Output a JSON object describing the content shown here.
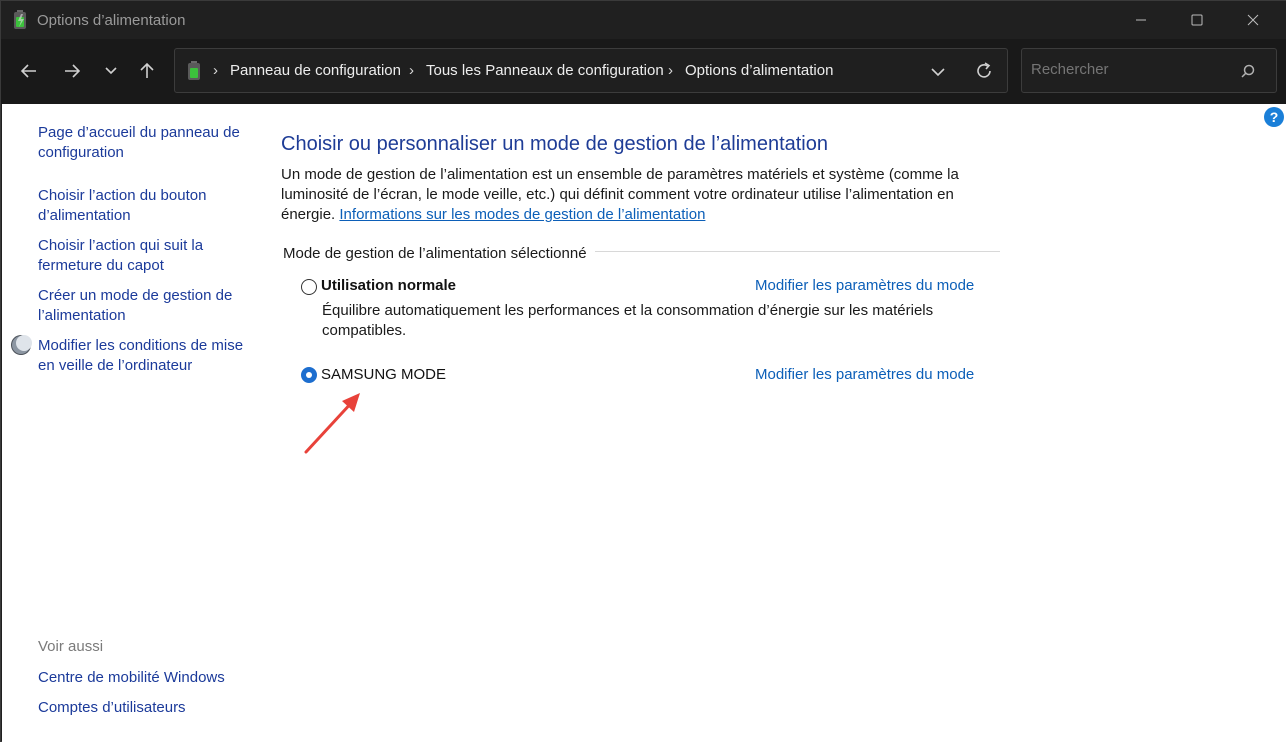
{
  "window": {
    "title": "Options d’alimentation"
  },
  "nav": {
    "breadcrumbs": [
      "Panneau de configuration",
      "Tous les Panneaux de configuration",
      "Options d’alimentation"
    ],
    "search_placeholder": "Rechercher"
  },
  "sidebar": {
    "links": [
      "Page d’accueil du panneau de configuration",
      "Choisir l’action du bouton d’alimentation",
      "Choisir l’action qui suit la fermeture du capot",
      "Créer un mode de gestion de l’alimentation",
      "Modifier les conditions de mise en veille de l’ordinateur"
    ],
    "see_also_label": "Voir aussi",
    "see_also_links": [
      "Centre de mobilité Windows",
      "Comptes d’utilisateurs"
    ]
  },
  "main": {
    "title": "Choisir ou personnaliser un mode de gestion de l’alimentation",
    "description": "Un mode de gestion de l’alimentation est un ensemble de paramètres matériels et système (comme la luminosité de l’écran, le mode veille, etc.) qui définit comment votre ordinateur utilise l’alimentation en énergie.",
    "info_link": "Informations sur les modes de gestion de l’alimentation",
    "section_label": "Mode de gestion de l’alimentation sélectionné",
    "plans": [
      {
        "name": "Utilisation normale",
        "description": "Équilibre automatiquement les performances et la consommation d’énergie sur les matériels compatibles.",
        "link": "Modifier les paramètres du mode",
        "selected": false
      },
      {
        "name": "SAMSUNG MODE",
        "link": "Modifier les paramètres du mode",
        "selected": true
      }
    ]
  },
  "colors": {
    "accent": "#1d6ecf",
    "link": "#0c5fb8",
    "heading": "#1e3c96",
    "annotation_arrow": "#e8423a"
  }
}
